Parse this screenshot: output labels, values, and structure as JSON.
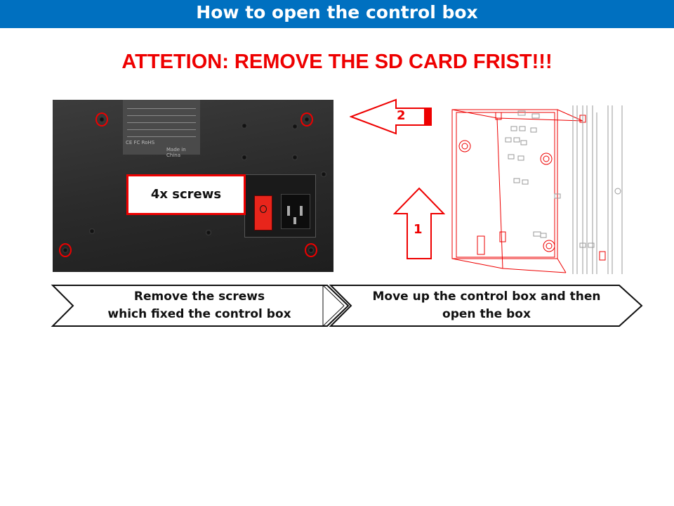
{
  "header": {
    "title": "How to open the control box"
  },
  "warning": {
    "text": "ATTETION: REMOVE THE SD CARD FRIST!!!"
  },
  "photo": {
    "callout": "4x screws",
    "plate_marks": "CE FC RoHS",
    "plate_origin": "Made in China"
  },
  "diagram": {
    "arrow_up_label": "1",
    "arrow_left_label": "2"
  },
  "steps": [
    {
      "line1": "Remove  the  screws",
      "line2": "which fixed the control  box"
    },
    {
      "line1": "Move   up the control  box and then",
      "line2": "open the box"
    }
  ],
  "colors": {
    "header_bg": "#0070c0",
    "accent_red": "#ee0000"
  }
}
